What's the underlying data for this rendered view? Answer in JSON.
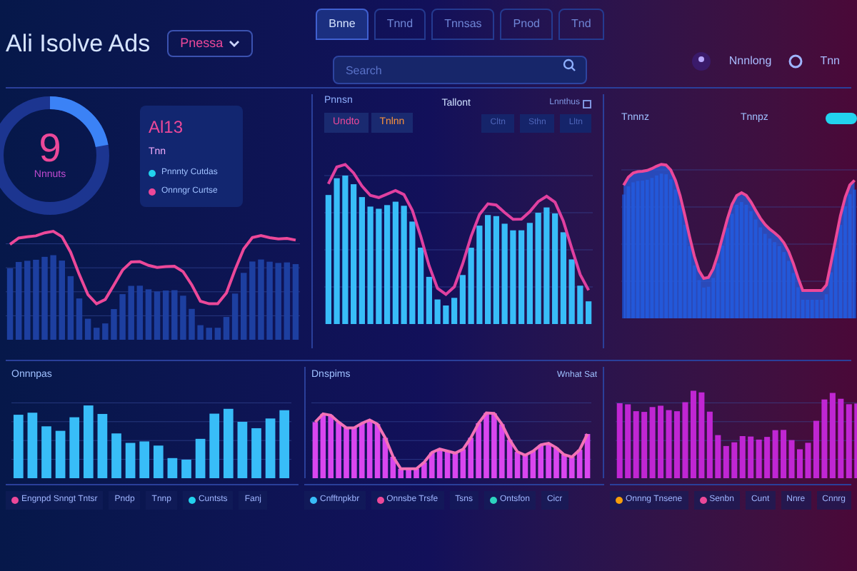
{
  "header": {
    "title": "Ali Isolve Ads",
    "dropdown": "Pnessa"
  },
  "tabs": [
    {
      "label": "Bnne",
      "selected": true
    },
    {
      "label": "Tnnd",
      "selected": false
    },
    {
      "label": "Tnnsas",
      "selected": false
    },
    {
      "label": "Pnod",
      "selected": false
    },
    {
      "label": "Tnd",
      "selected": false
    }
  ],
  "search": {
    "placeholder": "Search"
  },
  "header_actions": [
    "Nnnlong",
    "Tnn"
  ],
  "overview": {
    "value": "9",
    "unit": "Nnnuts",
    "level": 0.22,
    "card_title": "Al13",
    "card_subtitle": "Tnn",
    "legend": [
      {
        "label": "Pnnnty Cutdas",
        "color": "#22d3ee"
      },
      {
        "label": "Onnngr Curtse",
        "color": "#ec4899"
      }
    ]
  },
  "trend": {
    "label": "Pnnsn",
    "buttons": [
      "Undto",
      "Tnlnn"
    ],
    "title": "Tallont",
    "filters": [
      "Cltn",
      "Sthn",
      "Lltn"
    ],
    "checkbox": {
      "label": "Lnnthus",
      "checked": false
    }
  },
  "area": {
    "label": "Tnnnz",
    "title": "Tnnpz",
    "toggle": {
      "on": true
    }
  },
  "lower_panels": [
    {
      "title": "Onnnpas",
      "kind": "bars"
    },
    {
      "title": "Dnspims",
      "note": "Wnhat Sat",
      "kind": "line-bars"
    },
    {
      "kind": "tall-bars"
    }
  ],
  "legends": [
    [
      {
        "label": "Engnpd Snngt Tntsr",
        "color": "#ec4899"
      },
      {
        "label": "Pndp"
      },
      {
        "label": "Tnnp"
      },
      {
        "label": "Cuntsts",
        "color": "#22d3ee"
      },
      {
        "label": "Fanj"
      }
    ],
    [
      {
        "label": "Cnfftnpkbr",
        "color": "#38bdf8"
      },
      {
        "label": "Onnsbe Trsfe",
        "color": "#ec4899"
      },
      {
        "label": "Tsns"
      },
      {
        "label": "Ontsfon",
        "color": "#2dd4bf"
      },
      {
        "label": "Cicr"
      }
    ],
    [
      {
        "label": "Onnng Tnsene",
        "color": "#f59e0b"
      },
      {
        "label": "Senbn",
        "color": "#ec4899"
      },
      {
        "label": "Cunt"
      },
      {
        "label": "Nnre"
      },
      {
        "label": "Cnnrg"
      }
    ]
  ]
}
